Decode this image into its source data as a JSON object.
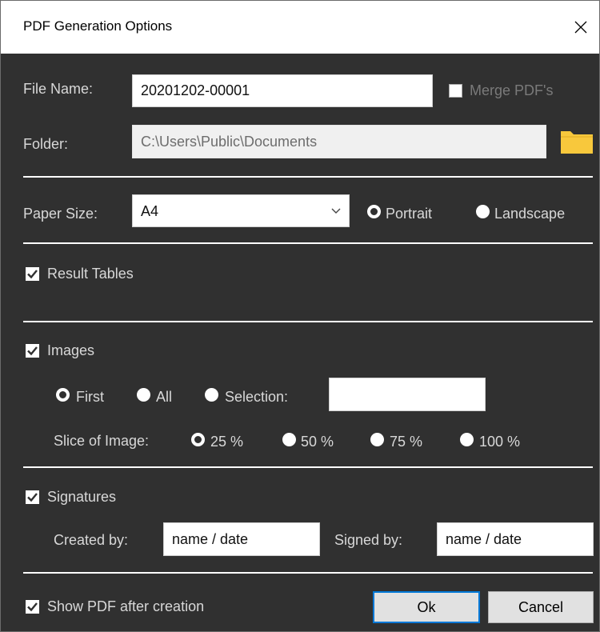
{
  "window": {
    "title": "PDF Generation Options"
  },
  "file": {
    "file_name_label": "File Name:",
    "file_name_value": "20201202-00001",
    "merge_label": "Merge PDF's",
    "folder_label": "Folder:",
    "folder_value": "C:\\Users\\Public\\Documents"
  },
  "paper": {
    "label": "Paper Size:",
    "selected": "A4",
    "portrait_label": "Portrait",
    "landscape_label": "Landscape",
    "orientation": "Portrait"
  },
  "result_tables": {
    "label": "Result Tables",
    "checked": true
  },
  "images": {
    "label": "Images",
    "checked": true,
    "first_label": "First",
    "all_label": "All",
    "selection_label": "Selection:",
    "selection_value": "",
    "selected_mode": "First",
    "slice_label": "Slice of Image:",
    "slice_options": [
      "25 %",
      "50 %",
      "75 %",
      "100 %"
    ],
    "slice_selected": "25 %"
  },
  "signatures": {
    "label": "Signatures",
    "checked": true,
    "created_by_label": "Created by:",
    "created_by_value": "name / date",
    "signed_by_label": "Signed by:",
    "signed_by_value": "name / date"
  },
  "footer": {
    "show_pdf_label": "Show PDF after creation",
    "show_pdf_checked": true,
    "ok_label": "Ok",
    "cancel_label": "Cancel"
  },
  "colors": {
    "background": "#303030",
    "text": "#d8d8d8",
    "folder_icon": "#f8c83c",
    "default_button_border": "#0078d7"
  },
  "icons": [
    "close-icon",
    "folder-icon",
    "chevron-down-icon",
    "checkmark-icon"
  ]
}
